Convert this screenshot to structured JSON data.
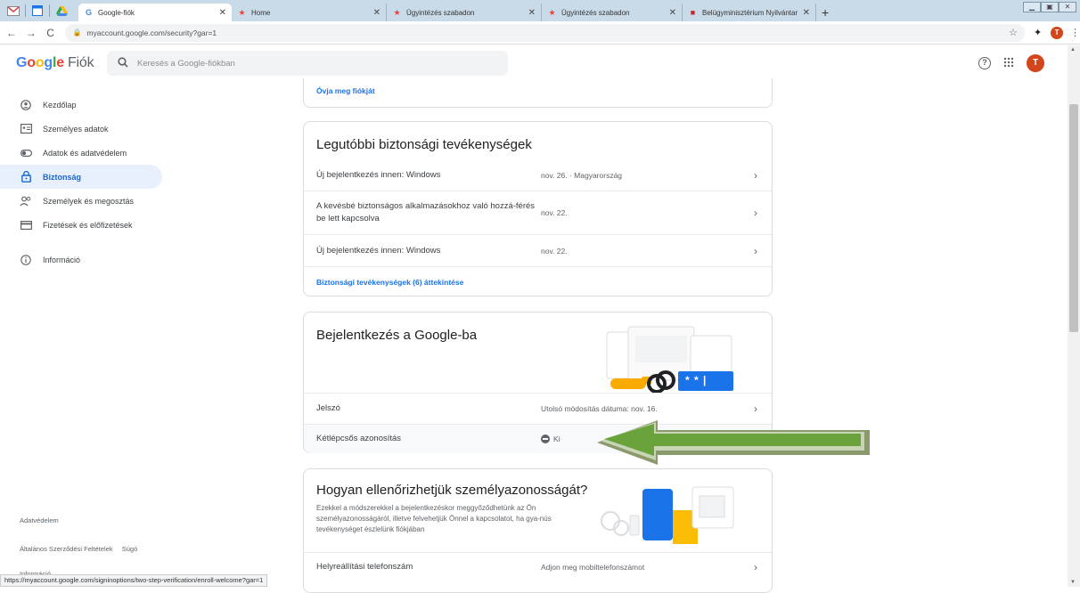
{
  "browser": {
    "pinned_tabs": [
      "mail-icon",
      "calendar-icon",
      "drive-icon"
    ],
    "tabs": [
      {
        "title": "Google-fiók",
        "favicon": "G",
        "favicon_color": "#4285f4",
        "active": true
      },
      {
        "title": "Home",
        "favicon": "★",
        "favicon_color": "#e8453c",
        "active": false
      },
      {
        "title": "Ügyintézés szabadon",
        "favicon": "★",
        "favicon_color": "#e8453c",
        "active": false
      },
      {
        "title": "Ügyintézés szabadon",
        "favicon": "★",
        "favicon_color": "#e8453c",
        "active": false
      },
      {
        "title": "Belügyminisztérium Nyilvántartá",
        "favicon": "■",
        "favicon_color": "#c62828",
        "active": false
      }
    ],
    "new_tab_label": "+",
    "url": "myaccount.google.com/security?gar=1",
    "profile_initial": "T"
  },
  "header": {
    "logo_google": [
      "G",
      "o",
      "o",
      "g",
      "l",
      "e"
    ],
    "logo_suffix": "Fiók",
    "search_placeholder": "Keresés a Google-fiókban",
    "avatar_initial": "T"
  },
  "sidebar": {
    "items": [
      {
        "label": "Kezdőlap",
        "icon": "home-icon",
        "active": false
      },
      {
        "label": "Személyes adatok",
        "icon": "id-card-icon",
        "active": false
      },
      {
        "label": "Adatok és adatvédelem",
        "icon": "toggle-icon",
        "active": false
      },
      {
        "label": "Biztonság",
        "icon": "lock-icon",
        "active": true
      },
      {
        "label": "Személyek és megosztás",
        "icon": "people-icon",
        "active": false
      },
      {
        "label": "Fizetések és előfizetések",
        "icon": "card-icon",
        "active": false
      },
      {
        "label": "Információ",
        "icon": "info-icon",
        "active": false
      }
    ],
    "footer": {
      "privacy": "Adatvédelem",
      "terms": "Általános Szerződési Feltételek",
      "help": "Súgó",
      "info": "Információ"
    }
  },
  "protect_card": {
    "link": "Óvja meg fiókját"
  },
  "recent_activity": {
    "title": "Legutóbbi biztonsági tevékenységek",
    "rows": [
      {
        "label": "Új bejelentkezés innen: Windows",
        "value": "nov. 26. · Magyarország"
      },
      {
        "label": "A kevésbé biztonságos alkalmazásokhoz való hozzá-férés be lett kapcsolva",
        "value": "nov. 22."
      },
      {
        "label": "Új bejelentkezés innen: Windows",
        "value": "nov. 22."
      }
    ],
    "review_link": "Biztonsági tevékenységek (6) áttekintése"
  },
  "signin": {
    "title": "Bejelentkezés a Google-ba",
    "password_mask": "* * |",
    "rows": [
      {
        "label": "Jelszó",
        "value": "Utolsó módosítás dátuma: nov. 16."
      },
      {
        "label": "Kétlépcsős azonosítás",
        "value": "Ki"
      }
    ]
  },
  "verify": {
    "title": "Hogyan ellenőrizhetjük személyazonosságát?",
    "description": "Ezekkel a módszerekkel a bejelentkezéskor meggyőződhetünk az Ön személyazonosságáról, illetve felvehetjük Önnel a kapcsolatot, ha gya-nús tevékenységet észlelünk fiókjában",
    "rows": [
      {
        "label": "Helyreállítási telefonszám",
        "value": "Adjon meg mobiltelefonszámot"
      }
    ]
  },
  "status_url": "https://myaccount.google.com/signinoptions/two-step-verification/enroll-welcome?gar=1",
  "colors": {
    "accent_blue": "#1a73e8",
    "active_nav_bg": "#e8f0fe",
    "arrow_green": "#6aa23c"
  }
}
